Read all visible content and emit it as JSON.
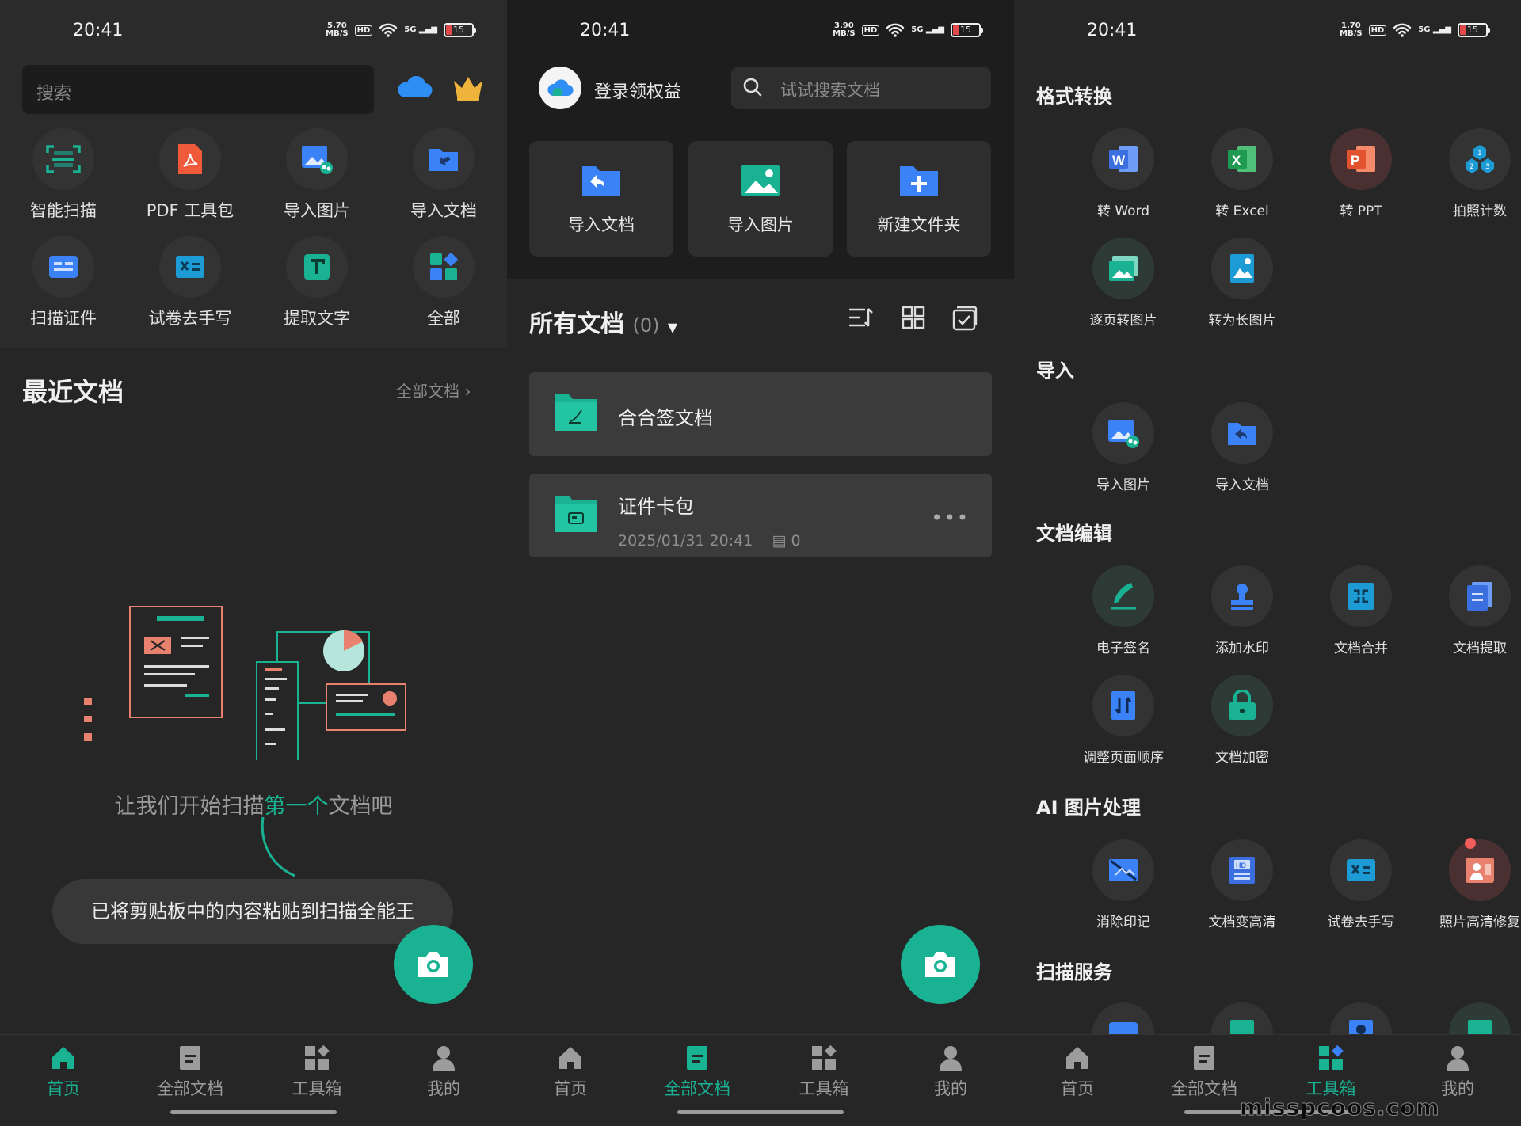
{
  "colors": {
    "accent": "#19b394",
    "background": "#262626"
  },
  "status_bar": [
    {
      "time": "20:41",
      "speed": "5.70",
      "speed_unit": "MB/S",
      "hd": "HD",
      "network": "5G",
      "battery": "15"
    },
    {
      "time": "20:41",
      "speed": "3.90",
      "speed_unit": "MB/S",
      "hd": "HD",
      "network": "5G",
      "battery": "15"
    },
    {
      "time": "20:41",
      "speed": "1.70",
      "speed_unit": "MB/S",
      "hd": "HD",
      "network": "5G",
      "battery": "15"
    }
  ],
  "home": {
    "search_placeholder": "搜索",
    "tools": [
      {
        "label": "智能扫描",
        "icon": "scan-icon"
      },
      {
        "label": "PDF 工具包",
        "icon": "pdf-icon"
      },
      {
        "label": "导入图片",
        "icon": "import-image-icon"
      },
      {
        "label": "导入文档",
        "icon": "import-doc-icon"
      },
      {
        "label": "扫描证件",
        "icon": "id-card-icon"
      },
      {
        "label": "试卷去手写",
        "icon": "exam-icon"
      },
      {
        "label": "提取文字",
        "icon": "text-extract-icon"
      },
      {
        "label": "全部",
        "icon": "grid-icon"
      }
    ],
    "recent_title": "最近文档",
    "all_docs_link": "全部文档",
    "empty_text_before": "让我们开始扫描",
    "empty_text_highlight": "第一个",
    "empty_text_after": "文档吧",
    "toast": "已将剪贴板中的内容粘贴到扫描全能王"
  },
  "nav": [
    {
      "home": "首页",
      "docs": "全部文档",
      "toolbox": "工具箱",
      "mine": "我的"
    },
    {
      "home": "首页",
      "docs": "全部文档",
      "toolbox": "工具箱",
      "mine": "我的"
    },
    {
      "home": "首页",
      "docs": "全部文档",
      "toolbox": "工具箱",
      "mine": "我的"
    }
  ],
  "docs": {
    "login_label": "登录领权益",
    "search_placeholder": "试试搜索文档",
    "quick_actions": [
      "导入文档",
      "导入图片",
      "新建文件夹"
    ],
    "section_title": "所有文档",
    "count": "(0)",
    "folders": [
      {
        "name": "合合签文档"
      },
      {
        "name": "证件卡包",
        "date": "2025/01/31 20:41",
        "pages": "0"
      }
    ]
  },
  "toolbox": {
    "sections": [
      {
        "title": "格式转换",
        "items": [
          "转 Word",
          "转 Excel",
          "转 PPT",
          "拍照计数",
          "逐页转图片",
          "转为长图片"
        ]
      },
      {
        "title": "导入",
        "items": [
          "导入图片",
          "导入文档"
        ]
      },
      {
        "title": "文档编辑",
        "items": [
          "电子签名",
          "添加水印",
          "文档合并",
          "文档提取",
          "调整页面顺序",
          "文档加密"
        ]
      },
      {
        "title": "AI 图片处理",
        "items": [
          "消除印记",
          "文档变高清",
          "试卷去手写",
          "照片高清修复"
        ]
      },
      {
        "title": "扫描服务",
        "items": []
      }
    ]
  },
  "watermark": "misspcoos.com"
}
